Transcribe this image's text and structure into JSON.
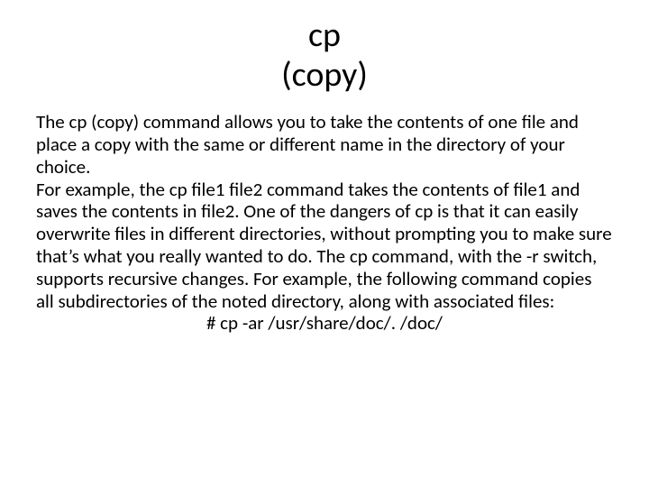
{
  "title": {
    "line1": "cp",
    "line2": "(copy)"
  },
  "body": {
    "p1_a": "The ",
    "p1_cmd": "cp (copy)",
    "p1_b": " command allows you to take the contents of one file and place a copy with the same or different name in the directory of your choice.",
    "p2_a": "For example, the ",
    "p2_cmd1": "cp file1 file2",
    "p2_b": " command takes the contents of file1 and saves the contents in file2. One of the dangers of ",
    "p2_cmd2": "cp",
    "p2_c": " is that it can easily overwrite files in different directories, without prompting you to make sure that’s what you really wanted to do. The ",
    "p2_cmd3": "cp",
    "p2_d": " command, with the ",
    "p2_sw": "-r",
    "p2_e": " switch, supports recursive changes. For example, the following command copies all subdirectories of the noted directory, along with associated files:",
    "example": "# cp -ar /usr/share/doc/. /doc/"
  }
}
